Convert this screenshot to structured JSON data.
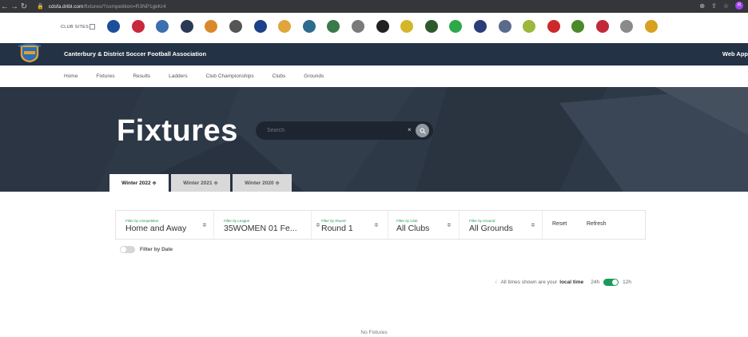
{
  "browser": {
    "url_host": "cdsfa.dribl.com",
    "url_path": "/fixtures/?competition=R3NP1gkKr4",
    "profile_initial": "R"
  },
  "club_sites": {
    "label": "CLUB SITES",
    "logo_colors": [
      "#1b4e9b",
      "#c8283c",
      "#3a6fb0",
      "#2a3a55",
      "#d9892b",
      "#555555",
      "#1e3f8a",
      "#e0a53c",
      "#2f6b8e",
      "#3a7a4a",
      "#7a7a7a",
      "#222222",
      "#d4b62a",
      "#2d5a2d",
      "#2fa84a",
      "#2a3c7a",
      "#5a6a8a",
      "#9bb83a",
      "#cc2a2a",
      "#4a8a2a",
      "#c22a3a",
      "#8a8a8a",
      "#d9a020"
    ]
  },
  "header": {
    "org_name": "Canterbury & District Soccer Football Association",
    "web_app": "Web App"
  },
  "nav": [
    "Home",
    "Fixtures",
    "Results",
    "Ladders",
    "Club Championships",
    "Clubs",
    "Grounds"
  ],
  "hero": {
    "title": "Fixtures",
    "search_placeholder": "Search",
    "clear_label": "×"
  },
  "seasons": [
    {
      "label": "Winter 2022 ≑",
      "active": true
    },
    {
      "label": "Winter 2021 ≑",
      "active": false
    },
    {
      "label": "Winter 2020 ≑",
      "active": false
    }
  ],
  "filters": {
    "competition": {
      "caption": "Filter by Competition",
      "value": "Home and Away"
    },
    "league": {
      "caption": "Filter by League",
      "value": "35WOMEN 01 Fe..."
    },
    "round": {
      "caption": "Filter by Round",
      "value": "Round 1"
    },
    "club": {
      "caption": "Filter by Club",
      "value": "All Clubs"
    },
    "ground": {
      "caption": "Filter by Ground",
      "value": "All Grounds"
    },
    "reset_label": "Reset",
    "refresh_label": "Refresh",
    "arrow_glyph": "≑"
  },
  "date_filter": {
    "label": "Filter by Date",
    "enabled": false
  },
  "time_display": {
    "prefix": "All times shown are your",
    "emphasis": "local time",
    "option_24": "24h",
    "option_12": "12h",
    "selected": "12h"
  },
  "empty_state": "No Fixtures"
}
